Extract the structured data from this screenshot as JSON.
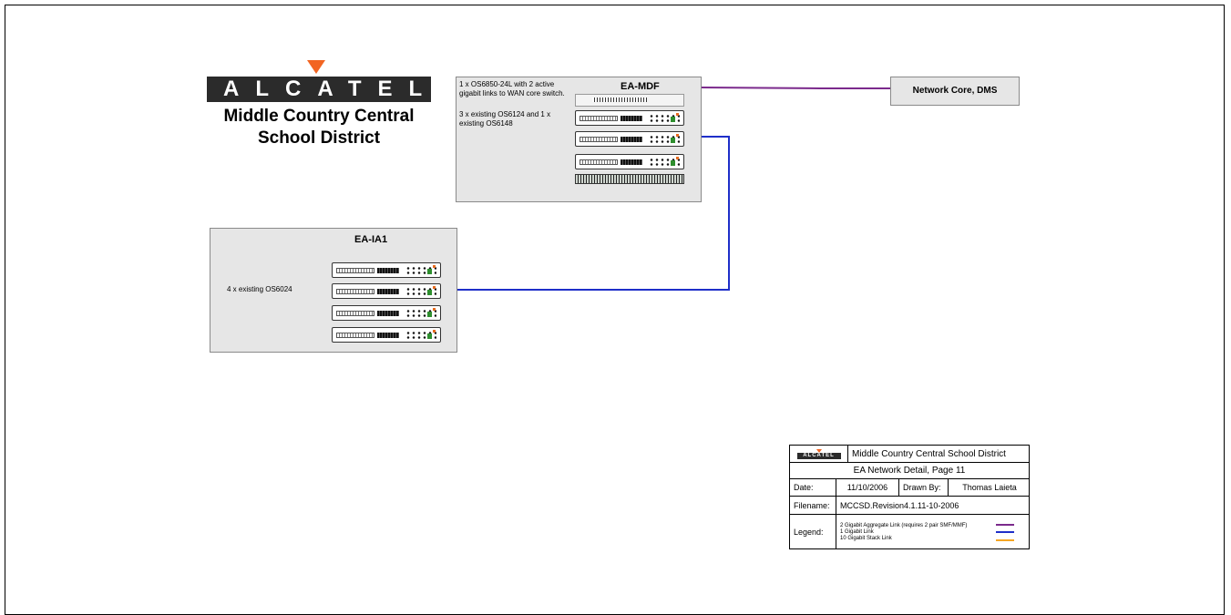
{
  "logo": {
    "wordmark": "ALCATEL",
    "organization_line1": "Middle Country Central",
    "organization_line2": "School District"
  },
  "mdf": {
    "title": "EA-MDF",
    "note1": "1 x OS6850-24L with 2 active gigabit links to WAN core switch.",
    "note2": "3 x existing OS6124 and 1 x existing OS6148"
  },
  "ia1": {
    "title": "EA-IA1",
    "note": "4 x existing OS6024"
  },
  "core": {
    "label": "Network Core, DMS"
  },
  "title_block": {
    "logo_text": "ALCATEL",
    "organization": "Middle Country Central School District",
    "page_title": "EA Network Detail, Page 11",
    "date_label": "Date:",
    "date_value": "11/10/2006",
    "drawn_by_label": "Drawn By:",
    "drawn_by_value": "Thomas Laieta",
    "filename_label": "Filename:",
    "filename_value": "MCCSD.Revision4.1.11-10-2006",
    "legend_label": "Legend:",
    "legend_items": [
      {
        "text": "2 Gigabit Aggregate Link (requires 2 pair SMF/MMF)",
        "color": "#7b2a8c"
      },
      {
        "text": "1 Gigabit Link",
        "color": "#1f2fc9"
      },
      {
        "text": "10 Gigabit Stack Link",
        "color": "#f5a623"
      }
    ]
  },
  "colors": {
    "aggregate_link": "#7b2a8c",
    "gigabit_link": "#1f2fc9",
    "stack_link": "#000000",
    "logo_accent": "#f26522"
  }
}
